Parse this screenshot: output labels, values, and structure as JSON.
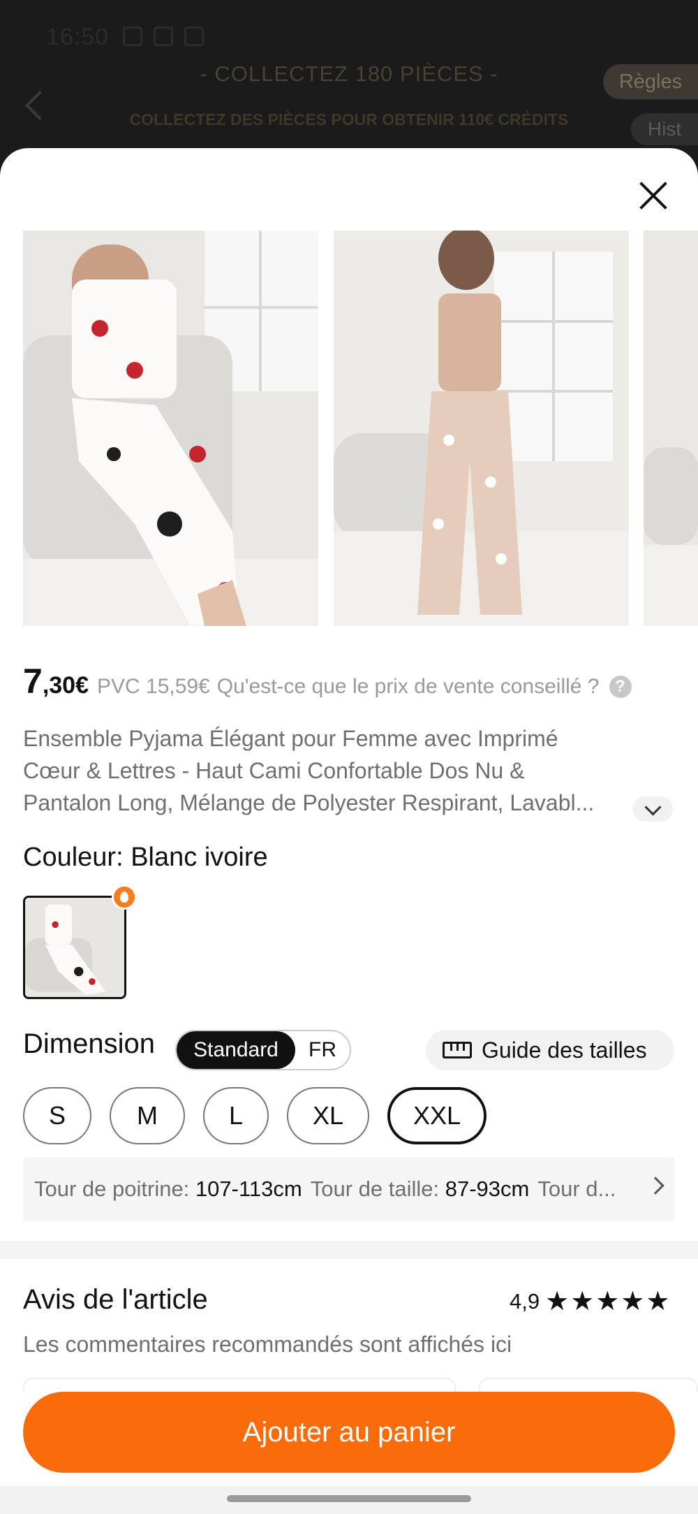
{
  "status_bar": {
    "time": "16:50"
  },
  "background": {
    "title": "- COLLECTEZ 180 PIÈCES -",
    "subtitle": "COLLECTEZ DES PIÈCES POUR OBTENIR 110€ CRÉDITS",
    "rules_label": "Règles",
    "history_label": "Hist"
  },
  "product": {
    "price_int": "7",
    "price_dec": ",30€",
    "pvc": "PVC 15,59€",
    "pvc_question": "Qu'est-ce que le prix de vente conseillé ?",
    "help_glyph": "?",
    "description_lines": [
      "Ensemble Pyjama Élégant pour Femme avec Imprimé",
      "Cœur & Lettres - Haut Cami Confortable Dos Nu &",
      "Pantalon Long, Mélange de Polyester Respirant, Lavabl..."
    ]
  },
  "color": {
    "label": "Couleur:",
    "value": "Blanc ivoire"
  },
  "dimension": {
    "label": "Dimension",
    "toggle": [
      "Standard",
      "FR"
    ],
    "size_guide_label": "Guide des tailles",
    "sizes": [
      "S",
      "M",
      "L",
      "XL",
      "XXL"
    ],
    "selected_size": "XXL"
  },
  "measurements": [
    {
      "key": "Tour de poitrine:",
      "value": "107-113cm"
    },
    {
      "key": "Tour de taille:",
      "value": "87-93cm"
    },
    {
      "key": "Tour d...",
      "value": ""
    }
  ],
  "reviews": {
    "title": "Avis de l'article",
    "rating": "4,9",
    "stars": 5,
    "subtitle": "Les commentaires recommandés sont affichés ici"
  },
  "cta": {
    "add_to_cart": "Ajouter au panier"
  },
  "colors": {
    "accent": "#fa6b0a",
    "text": "#111111",
    "muted": "#6f6f6f"
  }
}
